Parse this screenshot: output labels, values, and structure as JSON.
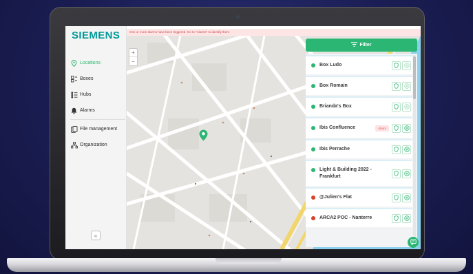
{
  "brand": {
    "logo": "SIEMENS",
    "accent": "#2bb673",
    "logo_color": "#019999"
  },
  "sidebar": {
    "items": [
      {
        "label": "Locations",
        "icon": "location-pin-icon",
        "active": true
      },
      {
        "label": "Boxes",
        "icon": "boxes-icon",
        "active": false
      },
      {
        "label": "Hubs",
        "icon": "hubs-icon",
        "active": false
      },
      {
        "label": "Alarms",
        "icon": "bell-icon",
        "active": false
      },
      {
        "label": "File management",
        "icon": "file-icon",
        "active": false
      },
      {
        "label": "Organization",
        "icon": "organization-icon",
        "active": false
      }
    ],
    "collapse_label": "«"
  },
  "alert": {
    "text": "One or more alarms have been triggered. Go to \"Alarms\" to identify them"
  },
  "map": {
    "zoom_in": "+",
    "zoom_out": "−"
  },
  "filter": {
    "label": "Filter"
  },
  "locations": [
    {
      "name": "Box Ludo",
      "status": "green",
      "badge": ""
    },
    {
      "name": "Box Romain",
      "status": "green",
      "badge": ""
    },
    {
      "name": "Brianda's Box",
      "status": "green",
      "badge": ""
    },
    {
      "name": "Ibis Confluence",
      "status": "green",
      "badge": "Alarm"
    },
    {
      "name": "Ibis Perrache",
      "status": "green",
      "badge": ""
    },
    {
      "name": "Light & Building 2022 - Frankfurt",
      "status": "green",
      "badge": ""
    },
    {
      "name": "@Julien's Flat",
      "status": "red",
      "badge": ""
    },
    {
      "name": "ARCA2 POC - Nanterre",
      "status": "red",
      "badge": ""
    }
  ],
  "status_colors": {
    "green": "#2bb673",
    "red": "#d9412b"
  }
}
